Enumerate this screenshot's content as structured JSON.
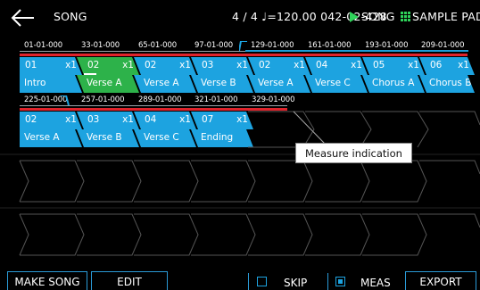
{
  "header": {
    "song_title": "SONG",
    "tempo_info": "4 / 4 ♩=120.00  042-02-428",
    "song_mode": "SONG",
    "pad_mode": "SAMPLE PAD"
  },
  "row1": {
    "measures": [
      "01-01-000",
      "33-01-000",
      "65-01-000",
      "97-01-000",
      "129-01-000",
      "161-01-000",
      "193-01-000",
      "209-01-000"
    ],
    "patterns": [
      {
        "num": "01",
        "rep": "x1"
      },
      {
        "num": "02",
        "rep": "x1"
      },
      {
        "num": "02",
        "rep": "x1"
      },
      {
        "num": "03",
        "rep": "x1"
      },
      {
        "num": "02",
        "rep": "x1"
      },
      {
        "num": "04",
        "rep": "x1"
      },
      {
        "num": "05",
        "rep": "x1"
      },
      {
        "num": "06",
        "rep": "x1"
      }
    ],
    "sections": [
      "Intro",
      "Verse A",
      "Verse A",
      "Verse B",
      "Verse A",
      "Verse C",
      "Chorus A",
      "Chorus B"
    ]
  },
  "row2": {
    "measures": [
      "225-01-000",
      "257-01-000",
      "289-01-000",
      "321-01-000",
      "329-01-000"
    ],
    "patterns": [
      {
        "num": "02",
        "rep": "x1"
      },
      {
        "num": "03",
        "rep": "x1"
      },
      {
        "num": "04",
        "rep": "x1"
      },
      {
        "num": "07",
        "rep": "x1"
      }
    ],
    "sections": [
      "Verse A",
      "Verse B",
      "Verse C",
      "Ending"
    ]
  },
  "callout": {
    "text": "Measure indication"
  },
  "footer": {
    "make_song": "MAKE SONG",
    "edit": "EDIT",
    "skip": "SKIP",
    "meas": "MEAS",
    "export": "EXPORT"
  },
  "colors": {
    "accent_blue": "#1da3e0",
    "selected_green": "#2db24a",
    "indicator_red": "#e0232b",
    "play_green": "#2fd35a"
  }
}
